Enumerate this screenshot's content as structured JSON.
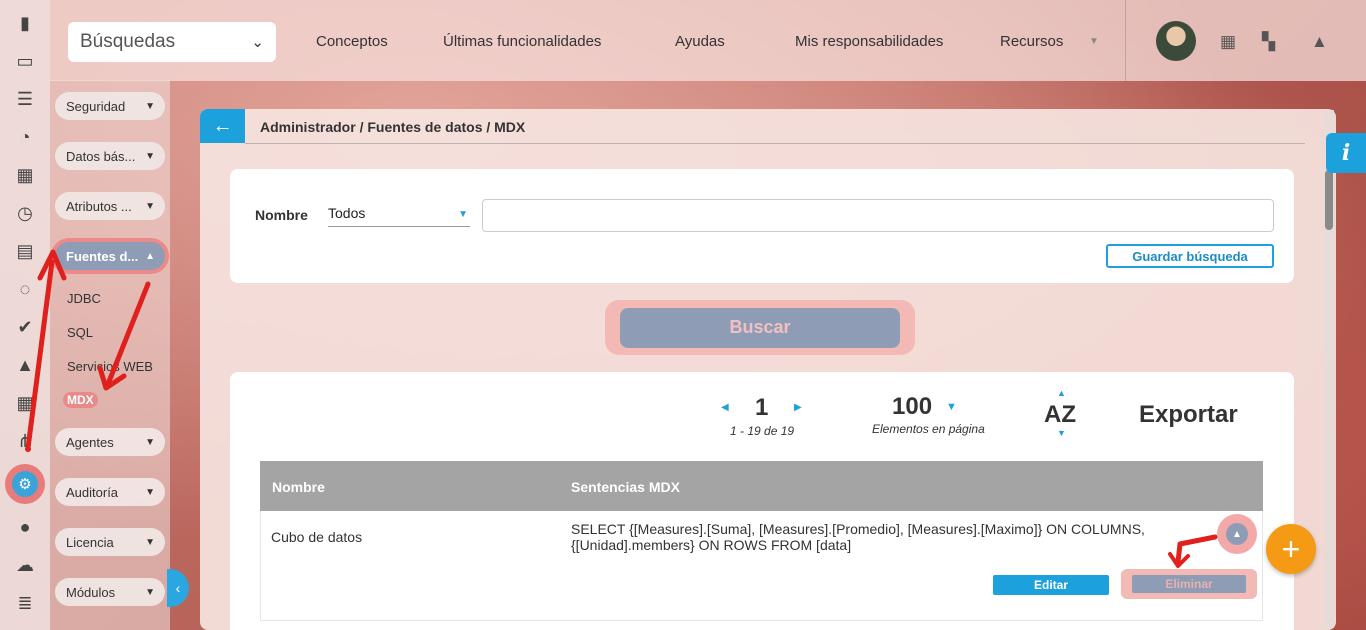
{
  "topbar": {
    "search_select": "Búsquedas",
    "nav": [
      "Conceptos",
      "Últimas funcionalidades",
      "Ayudas",
      "Mis responsabilidades",
      "Recursos"
    ]
  },
  "sidebar": {
    "groups": [
      "Seguridad",
      "Datos bás...",
      "Atributos ...",
      "Fuentes d...",
      "Agentes",
      "Auditoría",
      "Licencia",
      "Módulos"
    ],
    "sub_items": [
      "JDBC",
      "SQL",
      "Servicios WEB",
      "MDX"
    ]
  },
  "breadcrumb": "Administrador / Fuentes de datos / MDX",
  "filter": {
    "label": "Nombre",
    "select_value": "Todos",
    "text_value": "",
    "save_label": "Guardar búsqueda"
  },
  "search_button": "Buscar",
  "pagination": {
    "page": "1",
    "range": "1 - 19 de 19",
    "per_page": "100",
    "per_page_label": "Elementos en página",
    "sort": "AZ",
    "export": "Exportar"
  },
  "table": {
    "headers": [
      "Nombre",
      "Sentencias MDX"
    ],
    "rows": [
      {
        "name": "Cubo de datos",
        "sentence": "SELECT {[Measures].[Suma], [Measures].[Promedio], [Measures].[Maximo]} ON COLUMNS, {[Unidad].members} ON ROWS FROM [data]",
        "edit": "Editar",
        "delete": "Eliminar"
      }
    ]
  },
  "colors": {
    "accent": "#1ca1dc",
    "fab": "#f59a14",
    "annotation": "#e0201c"
  }
}
